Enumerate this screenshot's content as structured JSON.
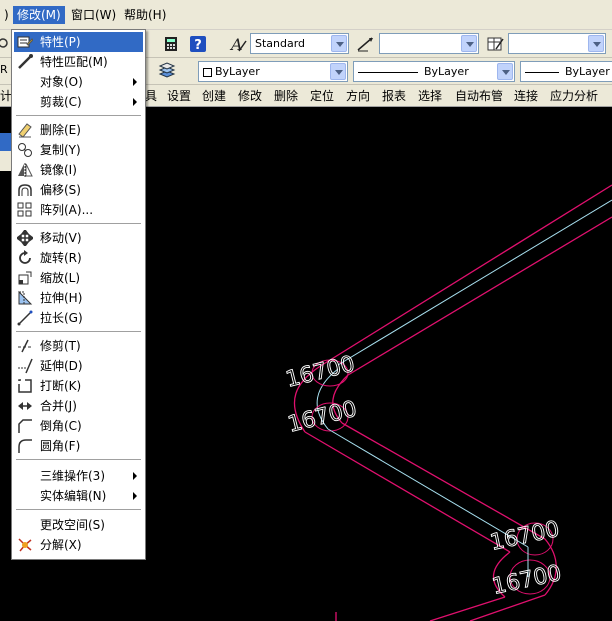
{
  "menubar": {
    "items": [
      {
        "label": ")"
      },
      {
        "label": "修改(M)"
      },
      {
        "label": "窗口(W)"
      },
      {
        "label": "帮助(H)"
      }
    ]
  },
  "toolbar": {
    "text_style": "Standard",
    "layer": "ByLayer",
    "linetype": "ByLayer",
    "lineweight": "ByLayer",
    "left_fragment": "R"
  },
  "custom_menu": {
    "items": [
      "设置",
      "创建",
      "修改",
      "删除",
      "定位",
      "方向",
      "报表",
      "选择",
      "自动布管",
      "连接",
      "应力分析"
    ],
    "left_fragment": "计",
    "mid_fragment": "具"
  },
  "dropdown": {
    "items": [
      {
        "label": "特性(P)",
        "icon": "properties-icon",
        "highlighted": true
      },
      {
        "label": "特性匹配(M)",
        "icon": "match-properties-icon"
      },
      {
        "label": "对象(O)",
        "submenu": true
      },
      {
        "label": "剪裁(C)",
        "submenu": true
      },
      {
        "label": "删除(E)",
        "icon": "erase-icon"
      },
      {
        "label": "复制(Y)",
        "icon": "copy-icon"
      },
      {
        "label": "镜像(I)",
        "icon": "mirror-icon"
      },
      {
        "label": "偏移(S)",
        "icon": "offset-icon"
      },
      {
        "label": "阵列(A)...",
        "icon": "array-icon"
      },
      {
        "label": "移动(V)",
        "icon": "move-icon"
      },
      {
        "label": "旋转(R)",
        "icon": "rotate-icon"
      },
      {
        "label": "缩放(L)",
        "icon": "scale-icon"
      },
      {
        "label": "拉伸(H)",
        "icon": "stretch-icon"
      },
      {
        "label": "拉长(G)",
        "icon": "lengthen-icon"
      },
      {
        "label": "修剪(T)",
        "icon": "trim-icon"
      },
      {
        "label": "延伸(D)",
        "icon": "extend-icon"
      },
      {
        "label": "打断(K)",
        "icon": "break-icon"
      },
      {
        "label": "合并(J)",
        "icon": "join-icon"
      },
      {
        "label": "倒角(C)",
        "icon": "chamfer-icon"
      },
      {
        "label": "圆角(F)",
        "icon": "fillet-icon"
      },
      {
        "label": "三维操作(3)",
        "submenu": true
      },
      {
        "label": "实体编辑(N)",
        "submenu": true
      },
      {
        "label": "更改空间(S)"
      },
      {
        "label": "分解(X)",
        "icon": "explode-icon"
      }
    ]
  },
  "drawing": {
    "dim_label": "16700",
    "colors": {
      "pipe": "#e0106e",
      "center": "#a8e0f0",
      "text": "#ffffff"
    }
  }
}
